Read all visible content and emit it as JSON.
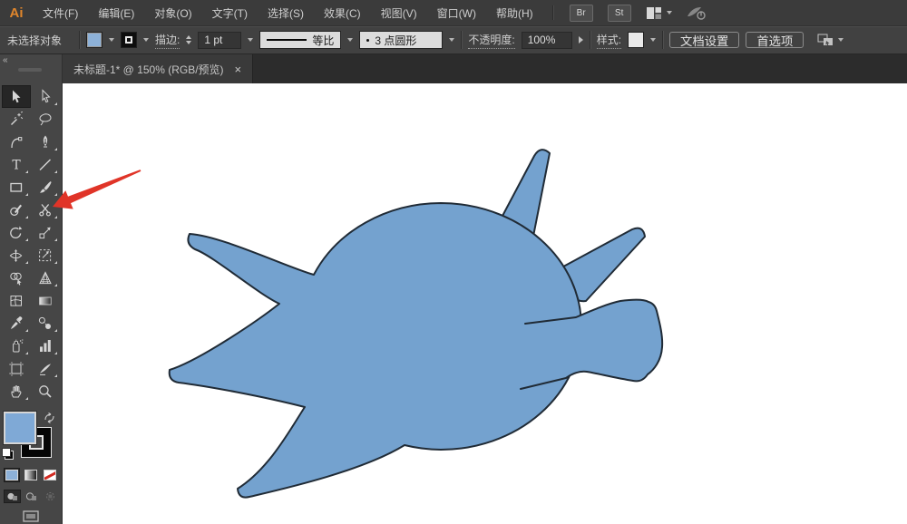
{
  "app": {
    "logo": "Ai"
  },
  "menubar": {
    "items": [
      {
        "id": "file",
        "label": "文件(F)"
      },
      {
        "id": "edit",
        "label": "编辑(E)"
      },
      {
        "id": "object",
        "label": "对象(O)"
      },
      {
        "id": "type",
        "label": "文字(T)"
      },
      {
        "id": "select",
        "label": "选择(S)"
      },
      {
        "id": "effect",
        "label": "效果(C)"
      },
      {
        "id": "view",
        "label": "视图(V)"
      },
      {
        "id": "window",
        "label": "窗口(W)"
      },
      {
        "id": "help",
        "label": "帮助(H)"
      }
    ],
    "bridge_label": "Br",
    "stock_label": "St"
  },
  "controlbar": {
    "selection_status": "未选择对象",
    "stroke_label": "描边:",
    "stroke_value": "1 pt",
    "profile_label": "等比",
    "brush_label": "3 点圆形",
    "opacity_label": "不透明度:",
    "opacity_value": "100%",
    "style_label": "样式:",
    "doc_setup_label": "文档设置",
    "preferences_label": "首选项"
  },
  "tab": {
    "title": "未标题-1* @ 150% (RGB/预览)",
    "close": "×",
    "collapse": "«"
  },
  "toolbar": {
    "tools": [
      {
        "id": "selection-tool",
        "active": true,
        "corner": false
      },
      {
        "id": "direct-selection-tool",
        "active": false,
        "corner": true
      },
      {
        "id": "magic-wand-tool",
        "active": false,
        "corner": false
      },
      {
        "id": "lasso-tool",
        "active": false,
        "corner": false
      },
      {
        "id": "curvature-tool",
        "active": false,
        "corner": false
      },
      {
        "id": "pen-tool",
        "active": false,
        "corner": true
      },
      {
        "id": "type-tool",
        "active": false,
        "corner": true
      },
      {
        "id": "line-segment-tool",
        "active": false,
        "corner": true
      },
      {
        "id": "rectangle-tool",
        "active": false,
        "corner": true
      },
      {
        "id": "paintbrush-tool",
        "active": false,
        "corner": true
      },
      {
        "id": "shaper-tool",
        "active": false,
        "corner": true
      },
      {
        "id": "scissors-tool",
        "active": false,
        "corner": true
      },
      {
        "id": "rotate-tool",
        "active": false,
        "corner": true
      },
      {
        "id": "scale-tool",
        "active": false,
        "corner": true
      },
      {
        "id": "width-tool",
        "active": false,
        "corner": true
      },
      {
        "id": "free-transform-tool",
        "active": false,
        "corner": true
      },
      {
        "id": "shape-builder-tool",
        "active": false,
        "corner": false
      },
      {
        "id": "perspective-grid-tool",
        "active": false,
        "corner": true
      },
      {
        "id": "mesh-tool",
        "active": false,
        "corner": false
      },
      {
        "id": "gradient-tool",
        "active": false,
        "corner": false
      },
      {
        "id": "eyedropper-tool",
        "active": false,
        "corner": true
      },
      {
        "id": "blend-tool",
        "active": false,
        "corner": true
      },
      {
        "id": "symbol-sprayer-tool",
        "active": false,
        "corner": true
      },
      {
        "id": "column-graph-tool",
        "active": false,
        "corner": true
      },
      {
        "id": "artboard-tool",
        "active": false,
        "corner": false
      },
      {
        "id": "slice-tool",
        "active": false,
        "corner": true
      },
      {
        "id": "hand-tool",
        "active": false,
        "corner": true
      },
      {
        "id": "zoom-tool",
        "active": false,
        "corner": false
      }
    ]
  },
  "canvas": {
    "shape_fill": "#74a2cf",
    "shape_stroke": "#202b36",
    "arrow_color": "#e03428",
    "fill_swatch": "#8db1d8",
    "panel_fill_swatch": "#7fa9d6"
  }
}
